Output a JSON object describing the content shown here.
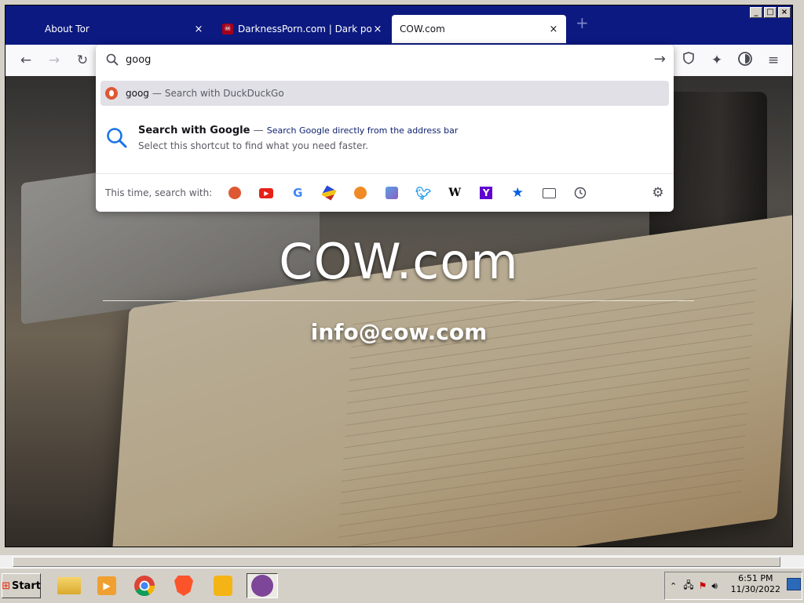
{
  "window": {
    "controls": [
      "_",
      "□",
      "×"
    ]
  },
  "tabs": [
    {
      "title": "About Tor",
      "close": "×"
    },
    {
      "title": "DarknessPorn.com | Dark porn - br",
      "close": "×"
    },
    {
      "title": "COW.com",
      "close": "×"
    }
  ],
  "new_tab_label": "+",
  "urlbar": {
    "value": "goog",
    "suggestion_primary": {
      "query": "goog",
      "separator": "—",
      "action": "Search with DuckDuckGo"
    },
    "suggestion_shortcut": {
      "title": "Search with Google",
      "separator": "—",
      "subtitle": "Search Google directly from the address bar",
      "hint": "Select this shortcut to find what you need faster."
    },
    "one_off_label": "This time, search with:",
    "engines": [
      "duckduckgo",
      "youtube",
      "google",
      "cube-engine",
      "startpage",
      "wikimedia-map",
      "twitter",
      "wikipedia",
      "yahoo",
      "bookmarks",
      "tabs",
      "history"
    ]
  },
  "page": {
    "brand": "COW.com",
    "email": "info@cow.com"
  },
  "taskbar": {
    "start_label": "Start",
    "time": "6:51 PM",
    "date": "11/30/2022"
  },
  "colors": {
    "titlebar": "#0c1980",
    "toolbar": "#f9f9fb",
    "ddg": "#de5833",
    "google_blue": "#1a73e8"
  }
}
